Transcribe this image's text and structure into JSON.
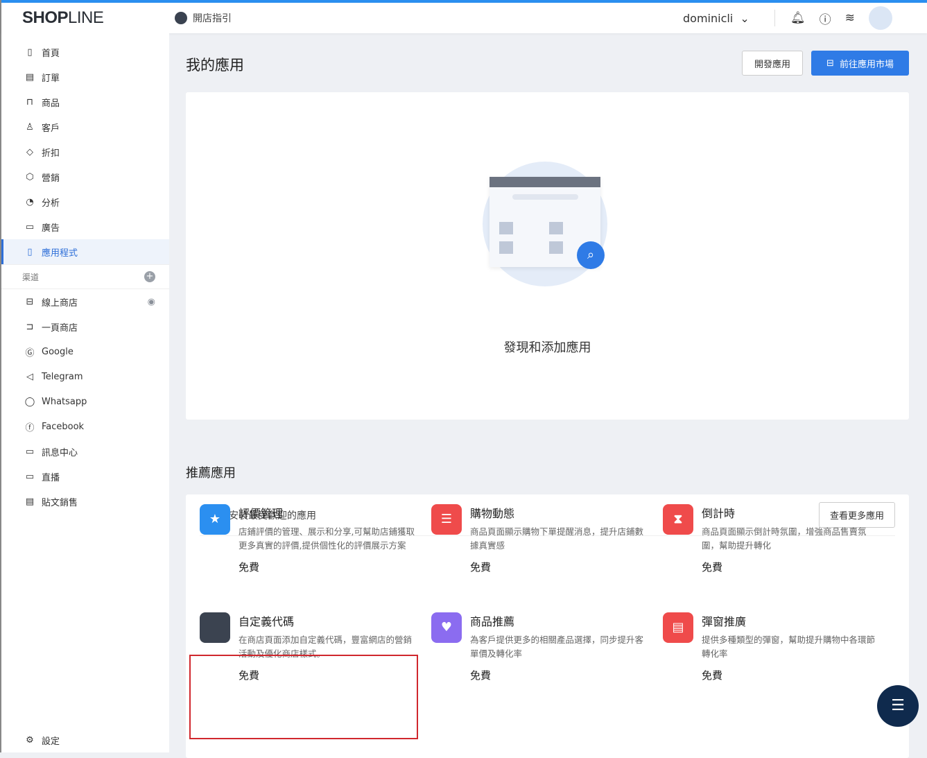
{
  "topbar": {
    "logo_bold": "SHOP",
    "logo_light": "LINE",
    "guide": "開店指引",
    "user": "dominicli"
  },
  "sidebar": {
    "items": [
      {
        "label": "首頁",
        "icon": "▯"
      },
      {
        "label": "訂單",
        "icon": "▤"
      },
      {
        "label": "商品",
        "icon": "⊓"
      },
      {
        "label": "客戶",
        "icon": "♙"
      },
      {
        "label": "折扣",
        "icon": "◇"
      },
      {
        "label": "營銷",
        "icon": "⬡"
      },
      {
        "label": "分析",
        "icon": "◔"
      },
      {
        "label": "廣告",
        "icon": "▭"
      },
      {
        "label": "應用程式",
        "icon": "▯"
      }
    ],
    "channels_label": "渠道",
    "channels": [
      {
        "label": "線上商店",
        "icon": "⊟"
      },
      {
        "label": "一頁商店",
        "icon": "⊐"
      },
      {
        "label": "Google",
        "icon": "Ⓖ"
      },
      {
        "label": "Telegram",
        "icon": "◁"
      },
      {
        "label": "Whatsapp",
        "icon": "◯"
      },
      {
        "label": "Facebook",
        "icon": "ⓕ"
      },
      {
        "label": "訊息中心",
        "icon": "▭"
      },
      {
        "label": "直播",
        "icon": "▭"
      },
      {
        "label": "貼文銷售",
        "icon": "▤"
      }
    ],
    "settings": "設定"
  },
  "main": {
    "title": "我的應用",
    "dev_button": "開發應用",
    "market_button": "前往應用市場",
    "empty_text": "發現和添加應用",
    "rec_title": "推薦應用",
    "rec_subtitle": "為店鋪安裝最受歡迎的應用",
    "more_button": "查看更多應用",
    "apps": [
      {
        "name": "評價管理",
        "desc": "店鋪評價的管理、展示和分享,可幫助店鋪獲取更多真實的評價,提供個性化的評價展示方案",
        "price": "免費",
        "color": "#2b8ff0"
      },
      {
        "name": "購物動態",
        "desc": "商品頁面顯示購物下單提醒消息，提升店鋪數據真實感",
        "price": "免費",
        "color": "#ef4b4b"
      },
      {
        "name": "倒計時",
        "desc": "商品頁面顯示倒計時氛圍，增強商品售賣氛圍，幫助提升轉化",
        "price": "免費",
        "color": "#ef4b4b"
      },
      {
        "name": "自定義代碼",
        "desc": "在商店頁面添加自定義代碼，豐富網店的營銷活動及優化商店樣式。",
        "price": "免費",
        "color": "#3b4350"
      },
      {
        "name": "商品推薦",
        "desc": "為客戶提供更多的相關產品選擇，同步提升客單價及轉化率",
        "price": "免費",
        "color": "#8b6cf0"
      },
      {
        "name": "彈窗推廣",
        "desc": "提供多種類型的彈窗，幫助提升購物中各環節轉化率",
        "price": "免費",
        "color": "#ef4b4b"
      }
    ]
  }
}
